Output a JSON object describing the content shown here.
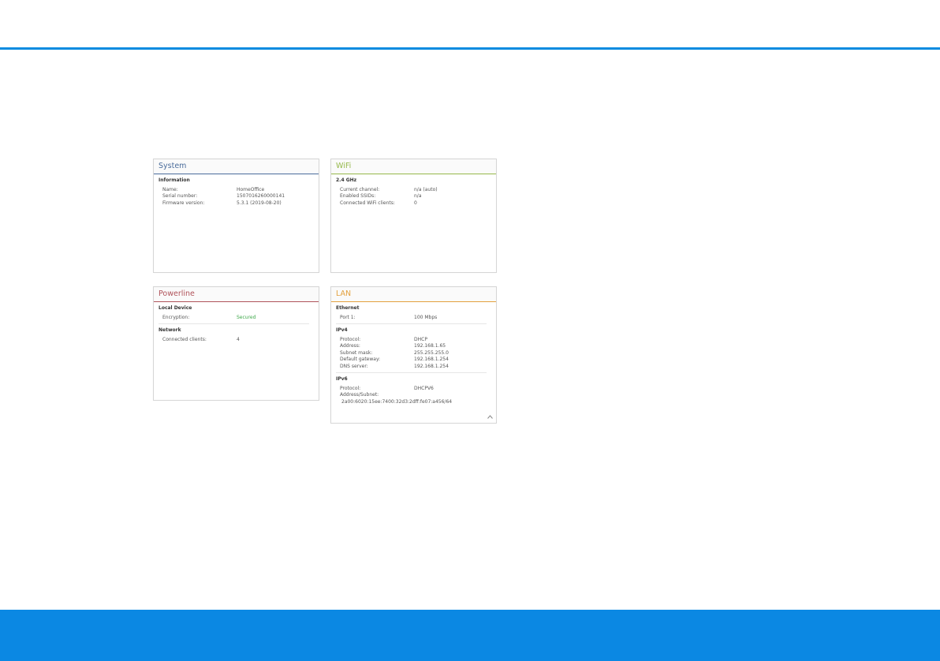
{
  "colors": {
    "accent_blue": "#0b88e3",
    "system": "#4a6c9b",
    "wifi": "#95b84a",
    "powerline": "#b0535a",
    "lan": "#e3a13f",
    "secured": "#3ea84a"
  },
  "system": {
    "title": "System",
    "section": "Information",
    "rows": [
      {
        "label": "Name:",
        "value": "HomeOffice"
      },
      {
        "label": "Serial number:",
        "value": "1507016260000141"
      },
      {
        "label": "Firmware version:",
        "value": "5.3.1 (2019-08-20)"
      }
    ]
  },
  "wifi": {
    "title": "WiFi",
    "section": "2.4 GHz",
    "rows": [
      {
        "label": "Current channel:",
        "value": "n/a (auto)"
      },
      {
        "label": "Enabled SSIDs:",
        "value": "n/a"
      },
      {
        "label": "Connected WiFi clients:",
        "value": "0"
      }
    ]
  },
  "powerline": {
    "title": "Powerline",
    "local_section": "Local Device",
    "encryption_label": "Encryption:",
    "encryption_value": "Secured",
    "network_section": "Network",
    "clients_label": "Connected clients:",
    "clients_value": "4"
  },
  "lan": {
    "title": "LAN",
    "ethernet_section": "Ethernet",
    "port_label": "Port 1:",
    "port_value": "100 Mbps",
    "ipv4_section": "IPv4",
    "ipv4_rows": [
      {
        "label": "Protocol:",
        "value": "DHCP"
      },
      {
        "label": "Address:",
        "value": "192.168.1.65"
      },
      {
        "label": "Subnet mask:",
        "value": "255.255.255.0"
      },
      {
        "label": "Default gateway:",
        "value": "192.168.1.254"
      },
      {
        "label": "DNS server:",
        "value": "192.168.1.254"
      }
    ],
    "ipv6_section": "IPv6",
    "ipv6_protocol_label": "Protocol:",
    "ipv6_protocol_value": "DHCPV6",
    "ipv6_address_label": "Address/Subnet:",
    "ipv6_address_value": "2a00:6020:15ee:7400:32d3:2dff:fe07:a456/64",
    "scroll_icon": "chevron-up-icon"
  }
}
